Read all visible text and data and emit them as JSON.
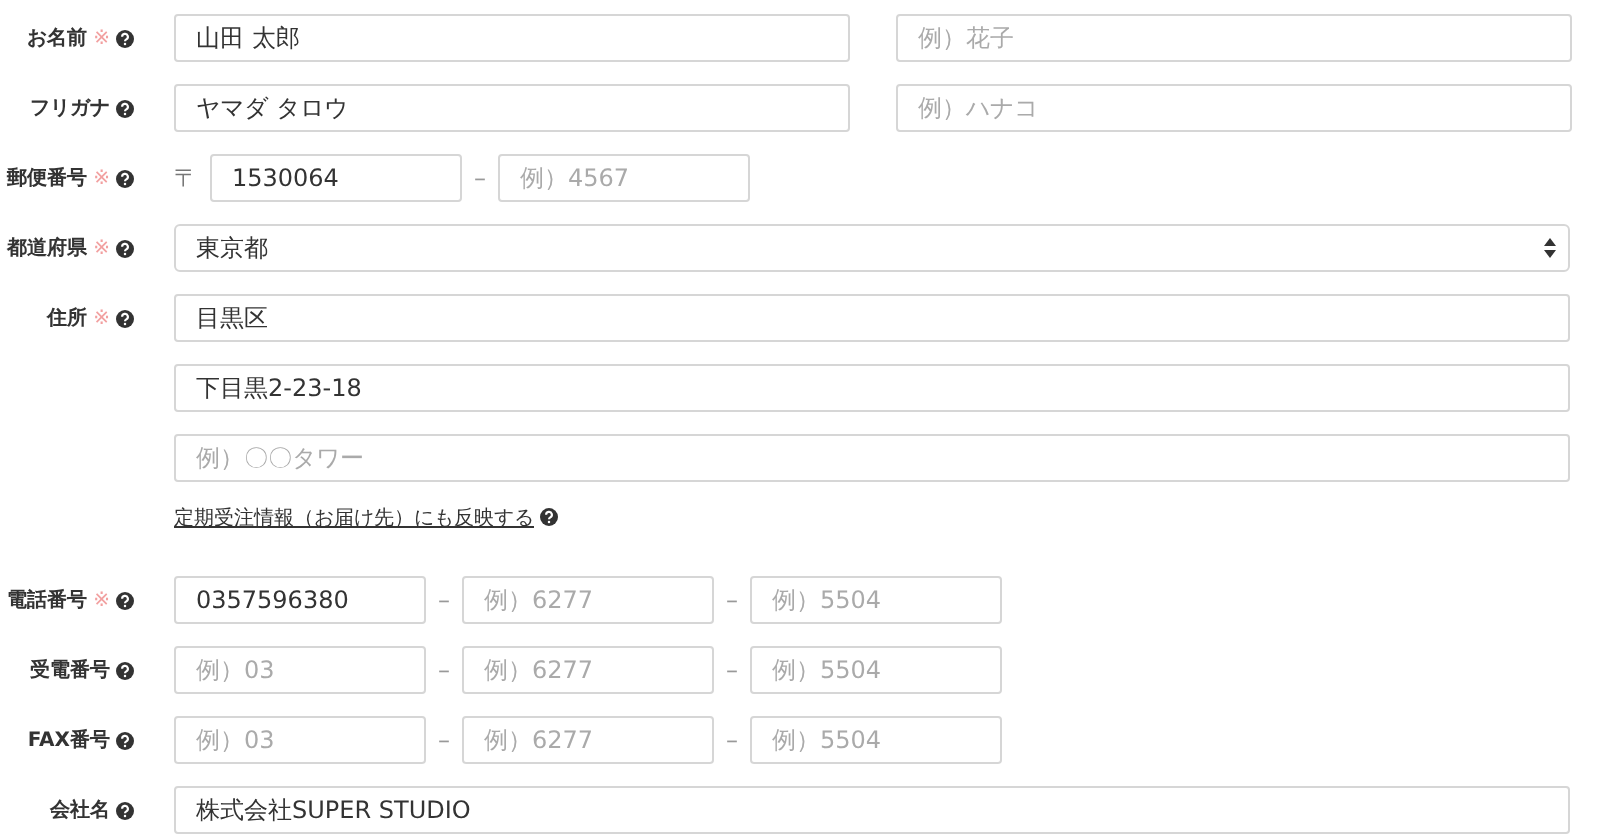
{
  "rows": [
    {
      "kind": "split",
      "label": "お名前",
      "required_mark": "※",
      "fields": [
        {
          "value": "山田 太郎"
        },
        {
          "placeholder": "例）花子"
        }
      ]
    },
    {
      "kind": "split",
      "label": "フリガナ",
      "fields": [
        {
          "value": "ヤマダ タロウ"
        },
        {
          "placeholder": "例）ハナコ"
        }
      ]
    },
    {
      "kind": "postal",
      "label": "郵便番号",
      "required_mark": "※",
      "prefix": "〒",
      "separator": "–",
      "fields": [
        {
          "value": "1530064"
        },
        {
          "placeholder": "例）4567"
        }
      ]
    },
    {
      "kind": "select",
      "label": "都道府県",
      "required_mark": "※",
      "fields": [
        {
          "value": "東京都"
        }
      ]
    },
    {
      "kind": "stack",
      "label": "住所",
      "required_mark": "※",
      "fields": [
        {
          "value": "目黒区"
        },
        {
          "value": "下目黒2-23-18"
        },
        {
          "placeholder": "例）〇〇タワー"
        }
      ],
      "link": "定期受注情報（お届け先）にも反映する"
    },
    {
      "kind": "triple",
      "label": "電話番号",
      "required_mark": "※",
      "separator": "–",
      "fields": [
        {
          "value": "0357596380"
        },
        {
          "placeholder": "例）6277"
        },
        {
          "placeholder": "例）5504"
        }
      ]
    },
    {
      "kind": "triple",
      "label": "受電番号",
      "separator": "–",
      "fields": [
        {
          "placeholder": "例）03"
        },
        {
          "placeholder": "例）6277"
        },
        {
          "placeholder": "例）5504"
        }
      ]
    },
    {
      "kind": "triple",
      "label": "FAX番号",
      "separator": "–",
      "fields": [
        {
          "placeholder": "例）03"
        },
        {
          "placeholder": "例）6277"
        },
        {
          "placeholder": "例）5504"
        }
      ]
    },
    {
      "kind": "full",
      "label": "会社名",
      "fields": [
        {
          "value": "株式会社SUPER STUDIO"
        }
      ]
    }
  ]
}
